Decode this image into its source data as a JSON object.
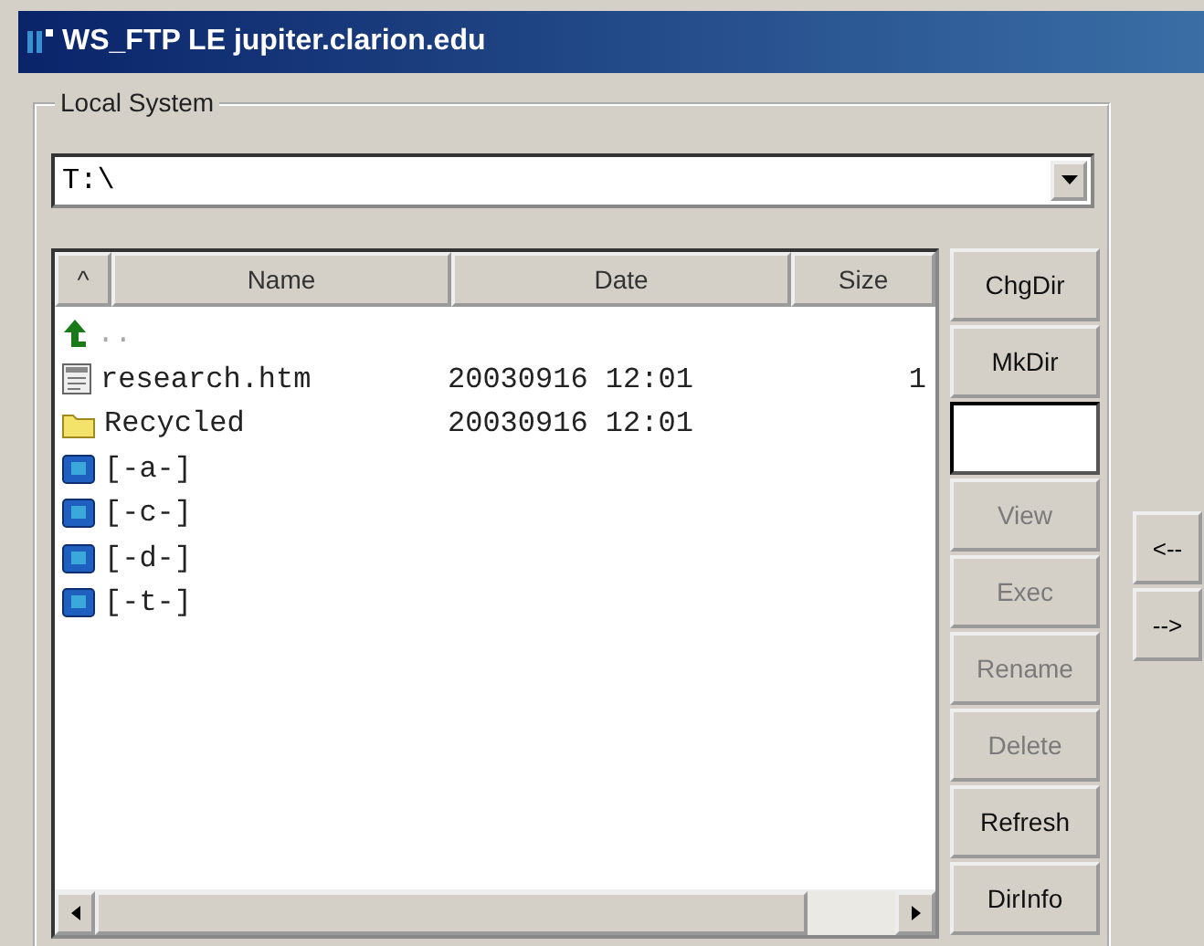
{
  "window": {
    "title": "WS_FTP LE jupiter.clarion.edu"
  },
  "local_system": {
    "label": "Local System",
    "path": "T:\\",
    "columns": [
      {
        "label": "^"
      },
      {
        "label": "Name"
      },
      {
        "label": "Date"
      },
      {
        "label": "Size"
      }
    ],
    "rows": [
      {
        "kind": "up",
        "name": "..",
        "date": "",
        "size": ""
      },
      {
        "kind": "file",
        "name": "research.htm",
        "date": "20030916 12:01",
        "size": "1"
      },
      {
        "kind": "folder",
        "name": "Recycled",
        "date": "20030916 12:01",
        "size": ""
      },
      {
        "kind": "drive",
        "name": "[-a-]",
        "date": "",
        "size": ""
      },
      {
        "kind": "drive",
        "name": "[-c-]",
        "date": "",
        "size": ""
      },
      {
        "kind": "drive",
        "name": "[-d-]",
        "date": "",
        "size": ""
      },
      {
        "kind": "drive",
        "name": "[-t-]",
        "date": "",
        "size": ""
      }
    ],
    "buttons": [
      {
        "kind": "button",
        "label": "ChgDir",
        "disabled": false
      },
      {
        "kind": "button",
        "label": "MkDir",
        "disabled": false
      },
      {
        "kind": "field"
      },
      {
        "kind": "button",
        "label": "View",
        "disabled": true
      },
      {
        "kind": "button",
        "label": "Exec",
        "disabled": true
      },
      {
        "kind": "button",
        "label": "Rename",
        "disabled": true
      },
      {
        "kind": "button",
        "label": "Delete",
        "disabled": true
      },
      {
        "kind": "button",
        "label": "Refresh",
        "disabled": false
      },
      {
        "kind": "button",
        "label": "DirInfo",
        "disabled": false
      }
    ]
  },
  "transfer_buttons": [
    {
      "label": "<--"
    },
    {
      "label": "-->"
    }
  ]
}
